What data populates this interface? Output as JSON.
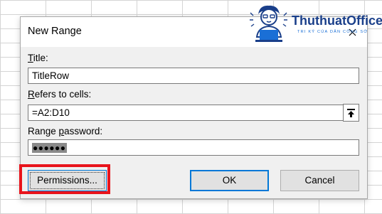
{
  "dialog": {
    "title": "New Range",
    "title_label": "Title:",
    "title_value": "TitleRow",
    "refers_label": "Refers to cells:",
    "refers_value": "=A2:D10",
    "password_label": "Range password:",
    "password_mask": "●●●●●●",
    "permissions_button": "Permissions...",
    "ok_button": "OK",
    "cancel_button": "Cancel"
  },
  "watermark": {
    "brand": "ThuthuatOffice",
    "tagline": "TRI KỶ CỦA DÂN CÔNG SỞ"
  },
  "colors": {
    "highlight": "#e8141c",
    "focus_blue": "#0078d7",
    "logo_blue": "#1a3f8a"
  }
}
